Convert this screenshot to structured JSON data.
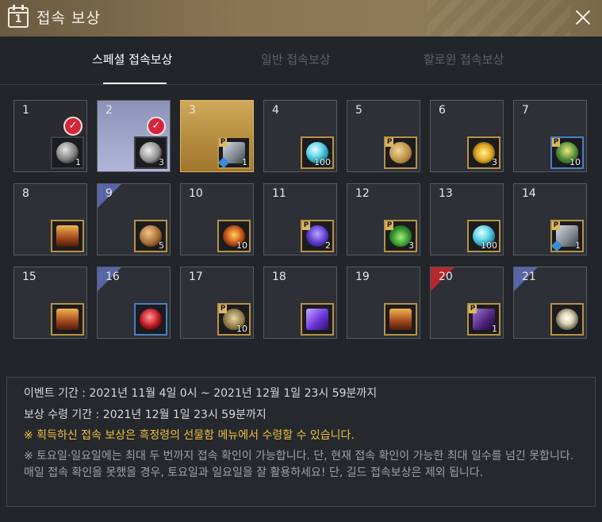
{
  "window": {
    "title": "접속 보상",
    "calendar_icon_number": "1",
    "close_icon": "close-icon"
  },
  "tabs": [
    {
      "label": "스페셜 접속보상",
      "active": true
    },
    {
      "label": "일반 접속보상",
      "active": false
    },
    {
      "label": "할로윈 접속보상",
      "active": false
    }
  ],
  "rewards": [
    {
      "day": "1",
      "claimed": true,
      "qty": "1",
      "icon": "armor-chest-icon"
    },
    {
      "day": "2",
      "claimed": true,
      "qty": "3",
      "icon": "armor-piece-icon"
    },
    {
      "day": "3",
      "today": true,
      "qty": "1",
      "icon": "gauntlet-icon",
      "premium": true,
      "level_badge": true
    },
    {
      "day": "4",
      "qty": "100",
      "icon": "blue-orb-icon"
    },
    {
      "day": "5",
      "qty": "",
      "icon": "rune-stone-icon",
      "premium": true
    },
    {
      "day": "6",
      "qty": "3",
      "icon": "butterfly-coin-icon"
    },
    {
      "day": "7",
      "qty": "10",
      "icon": "green-potion-icon",
      "premium": true
    },
    {
      "day": "8",
      "qty": "",
      "icon": "treasure-chest-icon"
    },
    {
      "day": "9",
      "qty": "5",
      "icon": "bronze-coin-icon",
      "corner": "blue"
    },
    {
      "day": "10",
      "qty": "10",
      "icon": "fire-orb-icon"
    },
    {
      "day": "11",
      "qty": "2",
      "icon": "purple-crystal-icon",
      "premium": true
    },
    {
      "day": "12",
      "qty": "3",
      "icon": "green-flask-icon",
      "premium": true
    },
    {
      "day": "13",
      "qty": "100",
      "icon": "blue-orb-icon"
    },
    {
      "day": "14",
      "qty": "1",
      "icon": "gauntlet-icon",
      "premium": true,
      "level_badge": true
    },
    {
      "day": "15",
      "qty": "",
      "icon": "treasure-chest-icon"
    },
    {
      "day": "16",
      "qty": "",
      "icon": "red-gem-icon",
      "corner": "blue"
    },
    {
      "day": "17",
      "qty": "10",
      "icon": "gold-potion-icon",
      "premium": true
    },
    {
      "day": "18",
      "qty": "",
      "icon": "gift-box-icon"
    },
    {
      "day": "19",
      "qty": "",
      "icon": "treasure-chest-icon"
    },
    {
      "day": "20",
      "qty": "1",
      "icon": "scroll-icon",
      "premium": true,
      "corner": "red"
    },
    {
      "day": "21",
      "qty": "",
      "icon": "sparkle-box-icon",
      "corner": "blue"
    }
  ],
  "info": {
    "event_period": "이벤트 기간 : 2021년 11월 4일 0시 ~ 2021년 12월 1일 23시 59분까지",
    "claim_period": "보상 수령 기간 : 2021년 12월 1일 23시 59분까지",
    "notice": "※ 획득하신 접속 보상은 흑정령의 선물함 메뉴에서 수령할 수 있습니다.",
    "detail": "※ 토요일·일요일에는 최대 두 번까지 접속 확인이 가능합니다. 단, 현재 접속 확인이 가능한 최대 일수를 넘긴 못합니다. 매일 접속 확인을 못했을 경우, 토요일과 일요일을 잘 활용하세요! 단, 길드 접속보상은 제외 됩니다."
  },
  "colors": {
    "title_bar": "#8a7655",
    "premium_badge": "#d9b764",
    "notice": "#f0bf3a",
    "today_cell": "#cfa959",
    "claimed_check": "#d3263a"
  }
}
